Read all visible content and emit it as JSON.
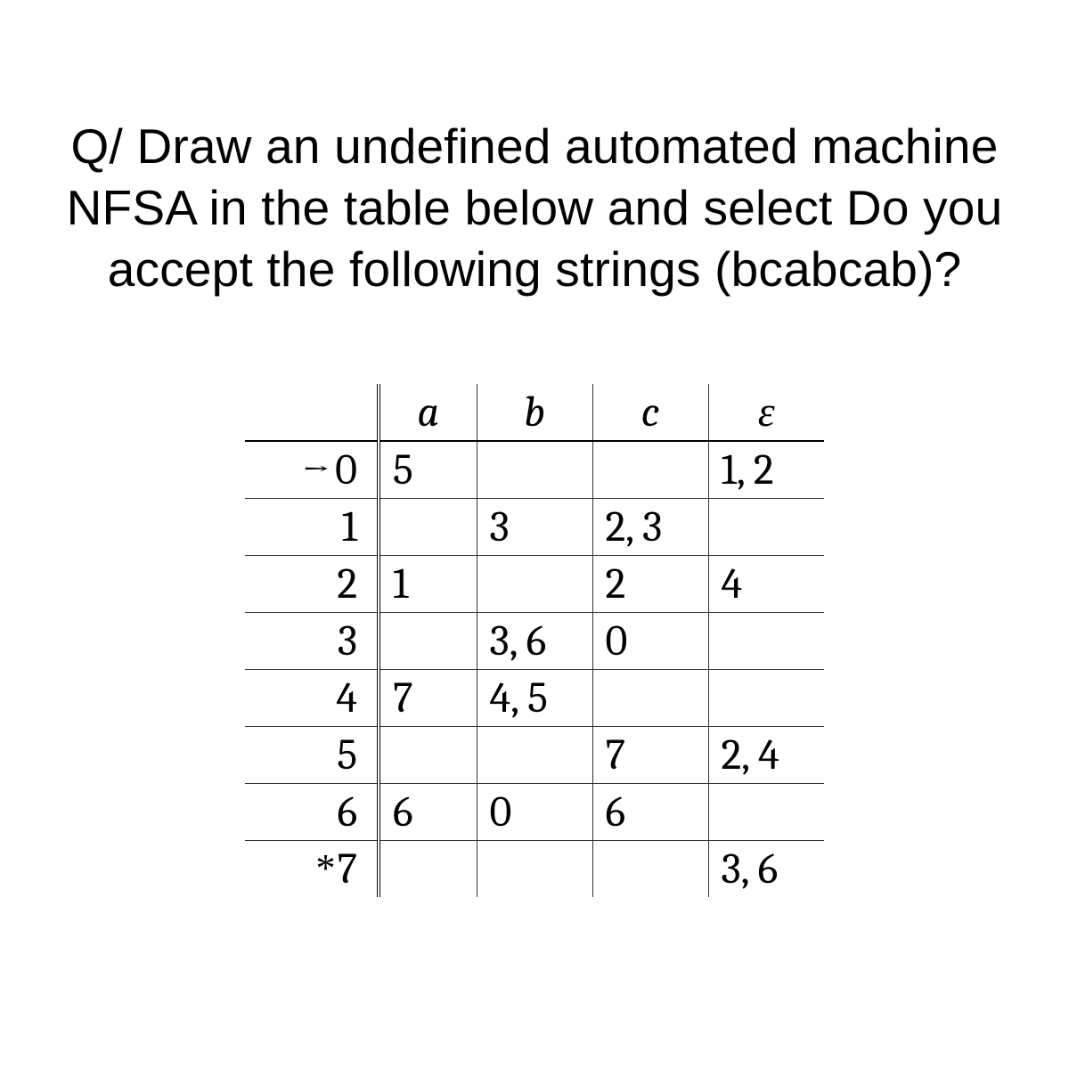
{
  "question": "Q/ Draw an undefined automated machine NFSA in the table below and select Do you accept the following strings (bcabcab)?",
  "headers": {
    "state": "",
    "a": "a",
    "b": "b",
    "c": "c",
    "eps": "ε"
  },
  "rows": [
    {
      "marker": "→",
      "state": "0",
      "a": "5",
      "b": "",
      "c": "",
      "eps": "1, 2"
    },
    {
      "marker": "",
      "state": "1",
      "a": "",
      "b": "3",
      "c": "2, 3",
      "eps": ""
    },
    {
      "marker": "",
      "state": "2",
      "a": "1",
      "b": "",
      "c": "2",
      "eps": "4"
    },
    {
      "marker": "",
      "state": "3",
      "a": "",
      "b": "3, 6",
      "c": "0",
      "eps": ""
    },
    {
      "marker": "",
      "state": "4",
      "a": "7",
      "b": "4, 5",
      "c": "",
      "eps": ""
    },
    {
      "marker": "",
      "state": "5",
      "a": "",
      "b": "",
      "c": "7",
      "eps": "2, 4"
    },
    {
      "marker": "",
      "state": "6",
      "a": "6",
      "b": "0",
      "c": "6",
      "eps": ""
    },
    {
      "marker": "*",
      "state": "7",
      "a": "",
      "b": "",
      "c": "",
      "eps": "3, 6"
    }
  ]
}
